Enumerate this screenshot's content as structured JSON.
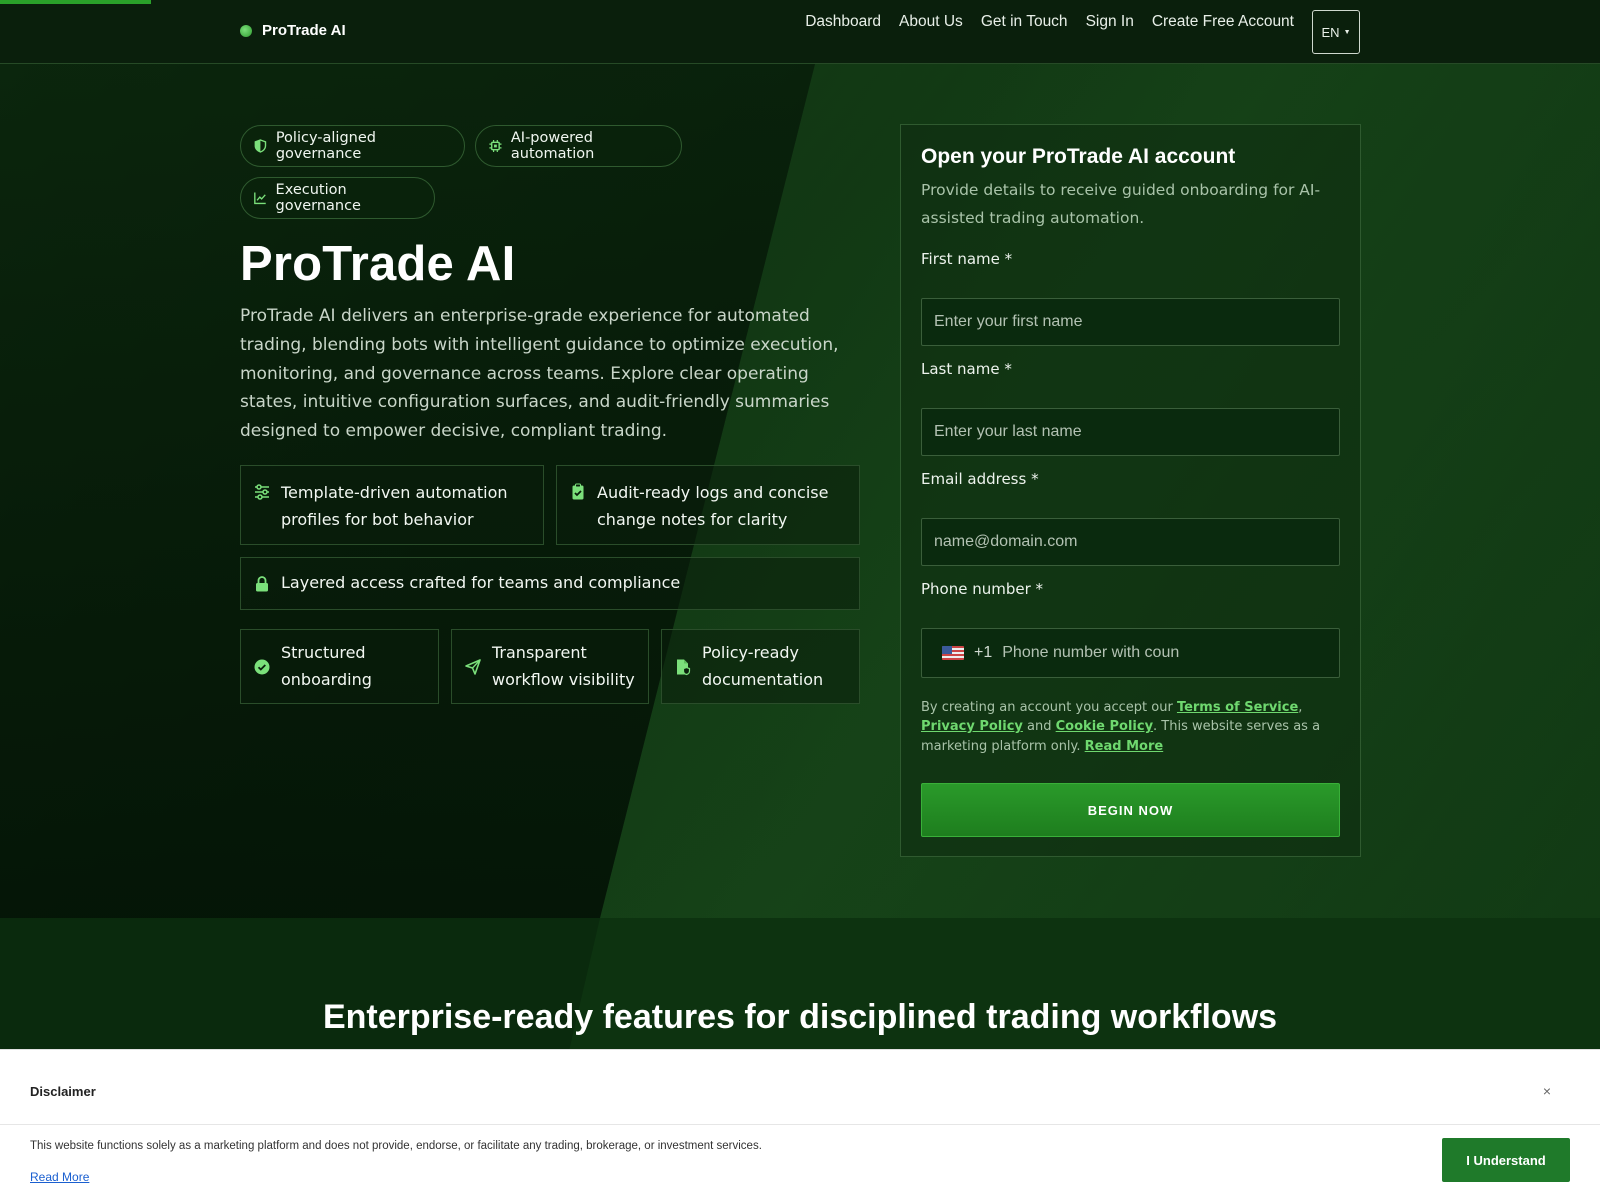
{
  "brand": {
    "name": "ProTrade AI"
  },
  "nav": {
    "items": [
      "Dashboard",
      "About Us",
      "Get in Touch",
      "Sign In",
      "Create Free Account"
    ],
    "language": "EN"
  },
  "hero": {
    "badges": [
      "Policy-aligned governance",
      "AI-powered automation",
      "Execution governance"
    ],
    "title": "ProTrade AI",
    "description": "ProTrade AI delivers an enterprise-grade experience for automated trading, blending bots with intelligent guidance to optimize execution, monitoring, and governance across teams. Explore clear operating states, intuitive configuration surfaces, and audit-friendly summaries designed to empower decisive, compliant trading.",
    "features": [
      "Template-driven automation profiles for bot behavior",
      "Audit-ready logs and concise change notes for clarity",
      "Layered access crafted for teams and compliance"
    ],
    "highlights": [
      "Structured onboarding",
      "Transparent workflow visibility",
      "Policy-ready documentation"
    ]
  },
  "form": {
    "title": "Open your ProTrade AI account",
    "subtitle": "Provide details to receive guided onboarding for AI-assisted trading automation.",
    "first_name": {
      "label": "First name *",
      "placeholder": "Enter your first name"
    },
    "last_name": {
      "label": "Last name *",
      "placeholder": "Enter your last name"
    },
    "email": {
      "label": "Email address *",
      "placeholder": "name@domain.com"
    },
    "phone": {
      "label": "Phone number *",
      "dial_code": "+1",
      "placeholder": "Phone number with coun"
    },
    "legal": {
      "prefix": "By creating an account you accept our ",
      "terms": "Terms of Service",
      "comma": ", ",
      "privacy": "Privacy Policy",
      "and": " and ",
      "cookie": "Cookie Policy",
      "suffix": ". This website serves as a marketing platform only. ",
      "read_more": "Read More"
    },
    "submit": "BEGIN NOW"
  },
  "section": {
    "title": "Enterprise-ready features for disciplined trading workflows"
  },
  "disclaimer": {
    "title": "Disclaimer",
    "close": "×",
    "text": "This website functions solely as a marketing platform and does not provide, endorse, or facilitate any trading, brokerage, or investment services.",
    "read_more": "Read More",
    "button": "I Understand"
  },
  "colors": {
    "accent": "#2aa12a",
    "link": "#6fd86f",
    "header_bg": "#0a1f0c",
    "cta": "#1f7a2a"
  }
}
